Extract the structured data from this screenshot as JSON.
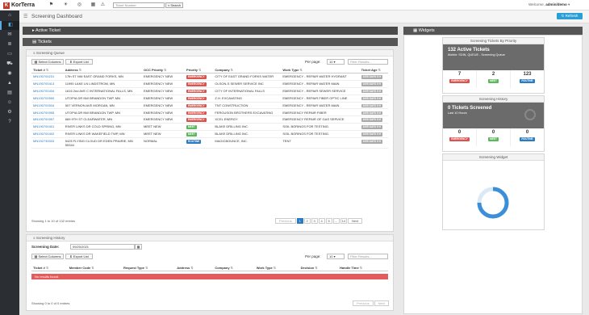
{
  "topbar": {
    "logo_text": "KorTerra",
    "search_placeholder": "Ticket Number",
    "search_label": "Search",
    "welcome_label": "Welcome,",
    "welcome_user": "admin/demo"
  },
  "page": {
    "title": "Screening Dashboard",
    "refresh_label": "Refresh"
  },
  "active_ticket": {
    "label": "Active Ticket"
  },
  "tickets": {
    "label": "Tickets",
    "queue_label": "Screening Queue",
    "select_columns": "Select Columns",
    "export_list": "Export List",
    "per_page_label": "Per page:",
    "per_page_value": "10",
    "filter_placeholder": "Filter Results...",
    "columns": [
      "Ticket #",
      "Address",
      "OCC Priority",
      "Priority",
      "Company",
      "Work Type",
      "Ticket Age"
    ],
    "rows": [
      {
        "ticket": "MN190700231",
        "address": "17th ST NW EAST GRAND FORKS, MN",
        "occ": "EMERGENCY NEW",
        "priority": "EMERGENCY",
        "ptype": "emergency",
        "company": "CITY OF EAST GRAND FORKS WATER",
        "work": "EMERGENCY - REPAIR WATER HYDRANT",
        "age": "1095 DAYS 5 H"
      },
      {
        "ticket": "MN190700413",
        "address": "11990 LAKE LN LINDSTROM, MN",
        "occ": "EMERGENCY NEW",
        "priority": "EMERGENCY",
        "ptype": "emergency",
        "company": "OLSON-S SEWER SERVICE INC",
        "work": "EMERGENCY - REPAIR WATER MAIN",
        "age": "1095 DAYS 5 H"
      },
      {
        "ticket": "MN190700434",
        "address": "1616 2nd AVE C INTERNATIONAL FALLS, MN",
        "occ": "EMERGENCY NEW",
        "priority": "EMERGENCY",
        "ptype": "emergency",
        "company": "CITY OF INTERNATIONAL FALLS",
        "work": "EMERGENCY - REPAIR SEWER SERVICE",
        "age": "1095 DAYS 5 H"
      },
      {
        "ticket": "MN190700590",
        "address": "UTOPIA DR NW BRANDON TWP, MN",
        "occ": "EMERGENCY NEW",
        "priority": "EMERGENCY",
        "ptype": "emergency",
        "company": "Z.H. EXCAVATING",
        "work": "EMERGENCY - REPAIR FIBER OPTIC LINE",
        "age": "1095 DAYS 5 H"
      },
      {
        "ticket": "MN190700534",
        "address": "507 VERNON AVE MORGAN, MN",
        "occ": "EMERGENCY NEW",
        "priority": "EMERGENCY",
        "ptype": "emergency",
        "company": "TNT CONSTRUCTION",
        "work": "EMERGENCY - REPAIR WATER MAIN",
        "age": "1095 DAYS 5 H"
      },
      {
        "ticket": "MN190700955",
        "address": "UTOPIA DR NW BRANDON TWP, MN",
        "occ": "EMERGENCY NEW",
        "priority": "EMERGENCY",
        "ptype": "emergency",
        "company": "FERGUSON BROTHERS EXCAVATING",
        "work": "EMERGENCY REPAIR FIBER",
        "age": "1095 DAYS 5 H"
      },
      {
        "ticket": "MN190700957",
        "address": "669 9TH ST CLEARWATER, MN",
        "occ": "EMERGENCY NEW",
        "priority": "EMERGENCY",
        "ptype": "emergency",
        "company": "XCEL ENERGY",
        "work": "EMERGENCY REPAIR OF GAS SERVICE",
        "age": "1095 DAYS 5 H"
      },
      {
        "ticket": "MN190700401",
        "address": "RIVER LINKS DR COLD SPRING, MN",
        "occ": "MEET NEW",
        "priority": "MEET",
        "ptype": "meet",
        "company": "BLAKE DRILLING INC.",
        "work": "SOIL BORINGS FOR TESTING.",
        "age": "1095 DAYS 5 H"
      },
      {
        "ticket": "MN190700402",
        "address": "RIVER LINKS DR WAKEFIELD TWP, MN",
        "occ": "MEET NEW",
        "priority": "MEET",
        "ptype": "meet",
        "company": "BLAKE DRILLING INC.",
        "work": "SOIL BORINGS FOR TESTING.",
        "age": "1095 DAYS 5 H"
      },
      {
        "ticket": "MN192730003",
        "address": "5425 FLYING CLOUD DR EDEN PRAIRIE, MN 55344",
        "occ": "NORMAL",
        "priority": "ROUTINE",
        "ptype": "routine",
        "company": "MAGICBOUNCE, INC.",
        "work": "TENT",
        "age": "1095 DAYS 5 H"
      }
    ],
    "showing": "Showing 1 to 10 of 132 entries",
    "pages": [
      "Previous",
      "1",
      "2",
      "3",
      "4",
      "5",
      "...",
      "14",
      "Next"
    ]
  },
  "history": {
    "label": "Screening History",
    "date_label": "Screening Date:",
    "date_value": "09/20/2021",
    "select_columns": "Select Columns",
    "export_list": "Export List",
    "per_page_label": "Per page:",
    "per_page_value": "10",
    "filter_placeholder": "Filter Results...",
    "columns": [
      "Ticket #",
      "Member Code",
      "Request Type",
      "Address",
      "Company",
      "Work Type",
      "Decision",
      "Handle Time"
    ],
    "no_results": "No results found.",
    "showing": "Showing 0 to 0 of 0 entries",
    "pages": [
      "Previous",
      "Next"
    ]
  },
  "widgets": {
    "label": "Widgets",
    "priority": {
      "title": "Screening Tickets By Priority",
      "headline": "132 Active Tickets",
      "sub": "Mobile: SDIN, QUEUE - Screening Queue",
      "stats": [
        {
          "num": "7",
          "label": "EMERGENCY",
          "type": "emergency"
        },
        {
          "num": "2",
          "label": "MEET",
          "type": "meet"
        },
        {
          "num": "123",
          "label": "ROUTINE",
          "type": "routine"
        }
      ]
    },
    "history": {
      "title": "Screening History",
      "headline": "0 Tickets Screened",
      "sub": "Last 10 Hours",
      "stats": [
        {
          "num": "0",
          "label": "EMERGENCY",
          "type": "emergency"
        },
        {
          "num": "0",
          "label": "MEET",
          "type": "meet"
        },
        {
          "num": "0",
          "label": "ROUTINE",
          "type": "routine"
        }
      ]
    },
    "screening": {
      "title": "Screening Widget"
    }
  },
  "colors": {
    "accent": "#2a7bbf",
    "emergency": "#d9534f",
    "meet": "#5cb85c",
    "routine": "#2a7bbf",
    "sidebar": "#2b2f33"
  },
  "icons": {
    "sidebar": [
      "home-icon",
      "dashboard-icon",
      "inbox-icon",
      "list-icon",
      "screen-icon",
      "truck-icon",
      "map-icon",
      "chart-icon",
      "document-icon",
      "user-icon",
      "settings-icon",
      "help-icon"
    ]
  }
}
